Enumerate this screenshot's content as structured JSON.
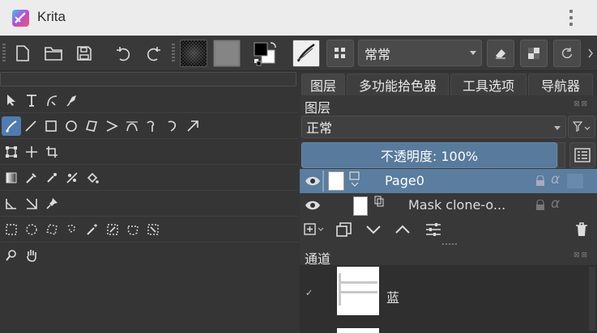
{
  "app": {
    "title": "Krita"
  },
  "toolbar": {
    "blend_mode": "常常",
    "icons": [
      "new-document-icon",
      "open-folder-icon",
      "save-icon",
      "undo-icon",
      "redo-icon",
      "gradient-icon",
      "pattern-icon",
      "fg-bg-color-icon",
      "brush-preset-icon",
      "layout-icon",
      "eraser-icon",
      "alpha-lock-icon",
      "reload-icon",
      "chevron-right-icon"
    ]
  },
  "tabs": [
    {
      "label": "图层"
    },
    {
      "label": "多功能拾色器"
    },
    {
      "label": "工具选项"
    },
    {
      "label": "导航器"
    }
  ],
  "layers_panel": {
    "title": "图层",
    "blend_mode": "正常",
    "opacity_label": "不透明度:  100%",
    "layers": [
      {
        "name": "Page0",
        "selected": true
      },
      {
        "name": "Mask clone-o...",
        "selected": false
      }
    ]
  },
  "channels_panel": {
    "title": "通道",
    "channels": [
      {
        "name": "蓝",
        "checked": true
      }
    ]
  },
  "colors": {
    "accent": "#5a7da0",
    "opacity_bar": "#587a9c",
    "active_tool": "#4f7bb0"
  }
}
